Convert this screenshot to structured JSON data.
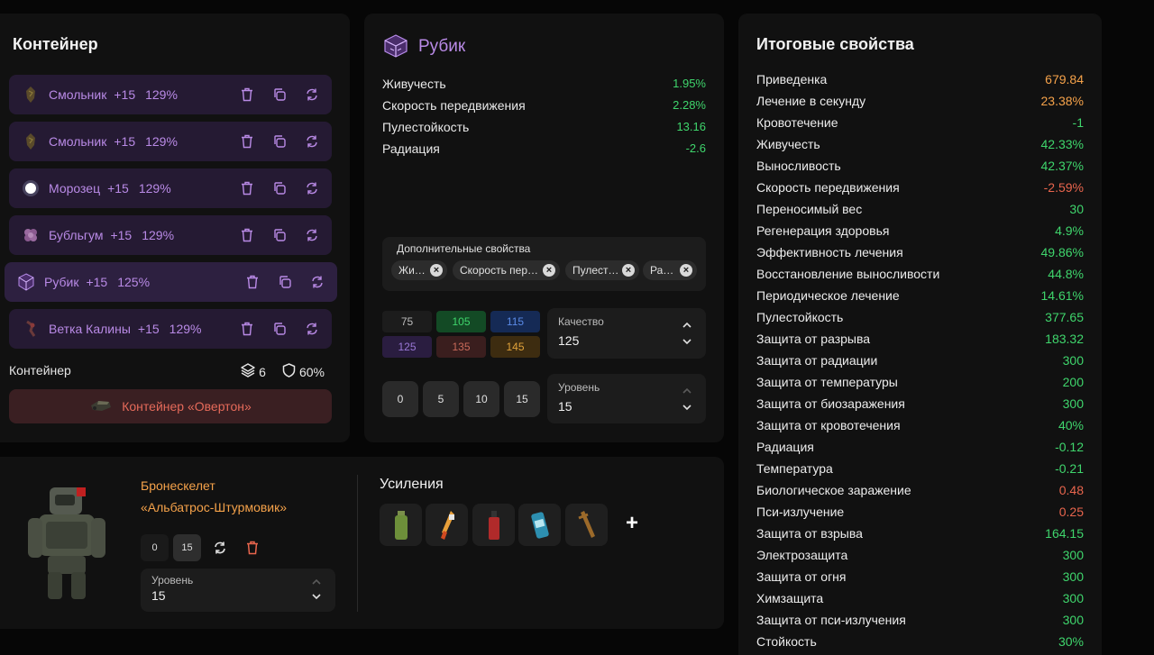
{
  "container_panel": {
    "title": "Контейнер",
    "artifacts": [
      {
        "name": "Смольник",
        "level": "+15",
        "percent": "129%",
        "icon": "smolnik-artifact-icon"
      },
      {
        "name": "Смольник",
        "level": "+15",
        "percent": "129%",
        "icon": "smolnik-artifact-icon"
      },
      {
        "name": "Морозец",
        "level": "+15",
        "percent": "129%",
        "icon": "morozets-artifact-icon"
      },
      {
        "name": "Бубльгум",
        "level": "+15",
        "percent": "129%",
        "icon": "bubblegum-artifact-icon"
      },
      {
        "name": "Рубик",
        "level": "+15",
        "percent": "125%",
        "icon": "rubik-artifact-icon"
      },
      {
        "name": "Ветка Калины",
        "level": "+15",
        "percent": "129%",
        "icon": "kalina-artifact-icon"
      }
    ],
    "footer_label": "Контейнер",
    "slots": "6",
    "protection": "60%",
    "container_button": "Контейнер «Овертон»"
  },
  "artifact_panel": {
    "title": "Рубик",
    "stats": [
      {
        "name": "Живучесть",
        "value": "1.95%"
      },
      {
        "name": "Скорость передвижения",
        "value": "2.28%"
      },
      {
        "name": "Пулестойкость",
        "value": "13.16"
      },
      {
        "name": "Радиация",
        "value": "-2.6"
      }
    ],
    "extra_label": "Дополнительные свойства",
    "extra_chips": [
      "Живучесть",
      "Скорость передвижения",
      "Пулестойкость",
      "Радиация"
    ],
    "quality_options": [
      "75",
      "105",
      "115",
      "125",
      "135",
      "145"
    ],
    "quality_label": "Качество",
    "quality_value": "125",
    "level_options": [
      "0",
      "5",
      "10",
      "15"
    ],
    "level_label": "Уровень",
    "level_value": "15"
  },
  "totals_panel": {
    "title": "Итоговые свойства",
    "rows": [
      {
        "name": "Приведенка",
        "value": "679.84",
        "color": "orange"
      },
      {
        "name": "Лечение в секунду",
        "value": "23.38%",
        "color": "orange"
      },
      {
        "name": "Кровотечение",
        "value": "-1",
        "color": "green"
      },
      {
        "name": "Живучесть",
        "value": "42.33%",
        "color": "green"
      },
      {
        "name": "Выносливость",
        "value": "42.37%",
        "color": "green"
      },
      {
        "name": "Скорость передвижения",
        "value": "-2.59%",
        "color": "red"
      },
      {
        "name": "Переносимый вес",
        "value": "30",
        "color": "green"
      },
      {
        "name": "Регенерация здоровья",
        "value": "4.9%",
        "color": "green"
      },
      {
        "name": "Эффективность лечения",
        "value": "49.86%",
        "color": "green"
      },
      {
        "name": "Восстановление выносливости",
        "value": "44.8%",
        "color": "green"
      },
      {
        "name": "Периодическое лечение",
        "value": "14.61%",
        "color": "green"
      },
      {
        "name": "Пулестойкость",
        "value": "377.65",
        "color": "green"
      },
      {
        "name": "Защита от разрыва",
        "value": "183.32",
        "color": "green"
      },
      {
        "name": "Защита от радиации",
        "value": "300",
        "color": "green"
      },
      {
        "name": "Защита от температуры",
        "value": "200",
        "color": "green"
      },
      {
        "name": "Защита от биозаражения",
        "value": "300",
        "color": "green"
      },
      {
        "name": "Защита от кровотечения",
        "value": "40%",
        "color": "green"
      },
      {
        "name": "Радиация",
        "value": "-0.12",
        "color": "green"
      },
      {
        "name": "Температура",
        "value": "-0.21",
        "color": "green"
      },
      {
        "name": "Биологическое заражение",
        "value": "0.48",
        "color": "red"
      },
      {
        "name": "Пси-излучение",
        "value": "0.25",
        "color": "red"
      },
      {
        "name": "Защита от взрыва",
        "value": "164.15",
        "color": "green"
      },
      {
        "name": "Электрозащита",
        "value": "300",
        "color": "green"
      },
      {
        "name": "Защита от огня",
        "value": "300",
        "color": "green"
      },
      {
        "name": "Химзащита",
        "value": "300",
        "color": "green"
      },
      {
        "name": "Защита от пси-излучения",
        "value": "300",
        "color": "green"
      },
      {
        "name": "Стойкость",
        "value": "30%",
        "color": "green"
      }
    ]
  },
  "armor_panel": {
    "name_line1": "Бронескелет",
    "name_line2": "«Альбатрос-Штурмовик»",
    "level_btn_0": "0",
    "level_btn_15": "15",
    "level_label": "Уровень",
    "level_value": "15",
    "boosts_title": "Усиления",
    "add_label": "+"
  },
  "colors": {
    "purple_text": "#b98ae6",
    "green": "#3fd56c",
    "orange": "#f5a24a",
    "red": "#e8654d"
  }
}
